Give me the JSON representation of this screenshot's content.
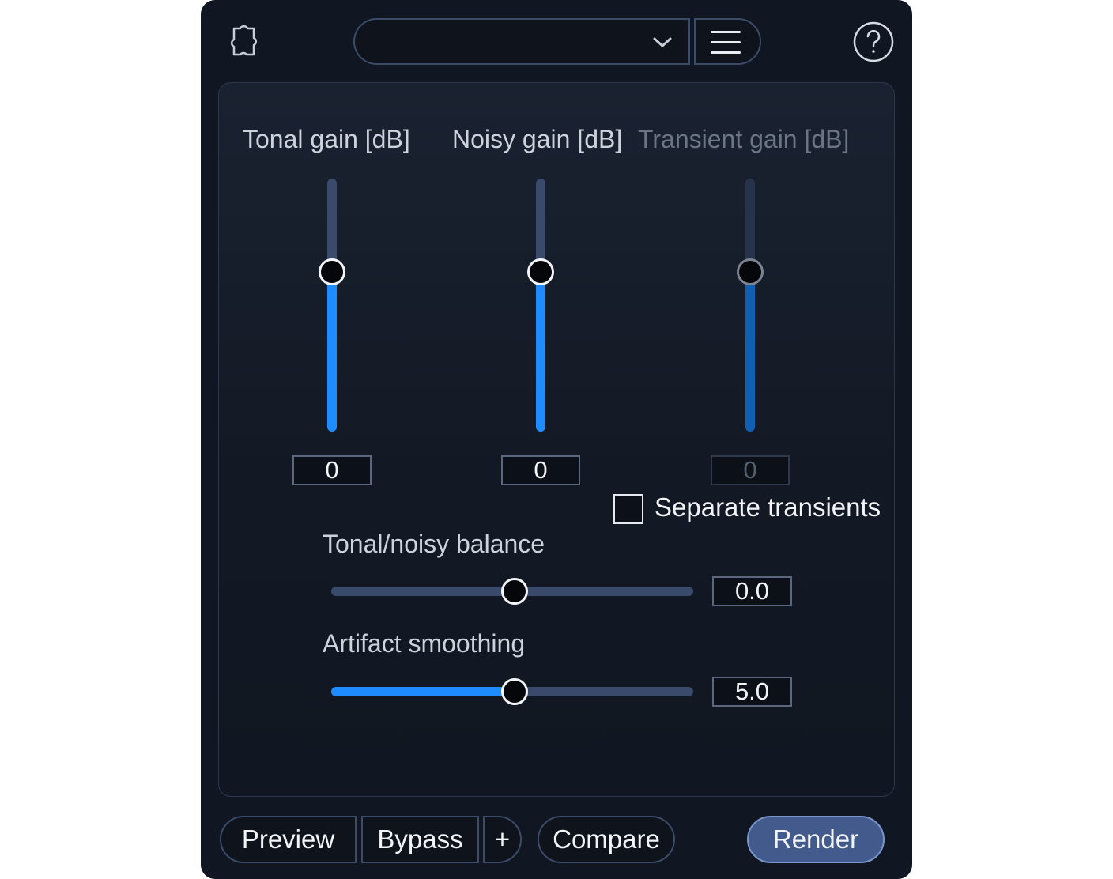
{
  "header": {
    "plugin_icon": "puzzle-icon",
    "preset_value": "",
    "preset_dropdown_icon": "chevron-down-icon",
    "menu_icon": "hamburger-menu-icon",
    "help_icon": "question-mark-icon"
  },
  "gains": [
    {
      "label": "Tonal gain [dB]",
      "value": "0",
      "level": 0.63,
      "enabled": true
    },
    {
      "label": "Noisy gain [dB]",
      "value": "0",
      "level": 0.63,
      "enabled": true
    },
    {
      "label": "Transient gain [dB]",
      "value": "0",
      "level": 0.63,
      "enabled": false
    }
  ],
  "separate_transients": {
    "label": "Separate transients",
    "checked": false
  },
  "balance": {
    "label": "Tonal/noisy balance",
    "value": "0.0",
    "level": 0.5
  },
  "smoothing": {
    "label": "Artifact smoothing",
    "value": "5.0",
    "level": 0.5
  },
  "footer": {
    "preview": "Preview",
    "bypass": "Bypass",
    "plus": "+",
    "compare": "Compare",
    "render": "Render"
  },
  "colors": {
    "background": "#111722",
    "accent": "#1e8bff",
    "accent_disabled": "#0f5fb3",
    "track": "#3a4a6b",
    "render_button": "#425a8c"
  }
}
